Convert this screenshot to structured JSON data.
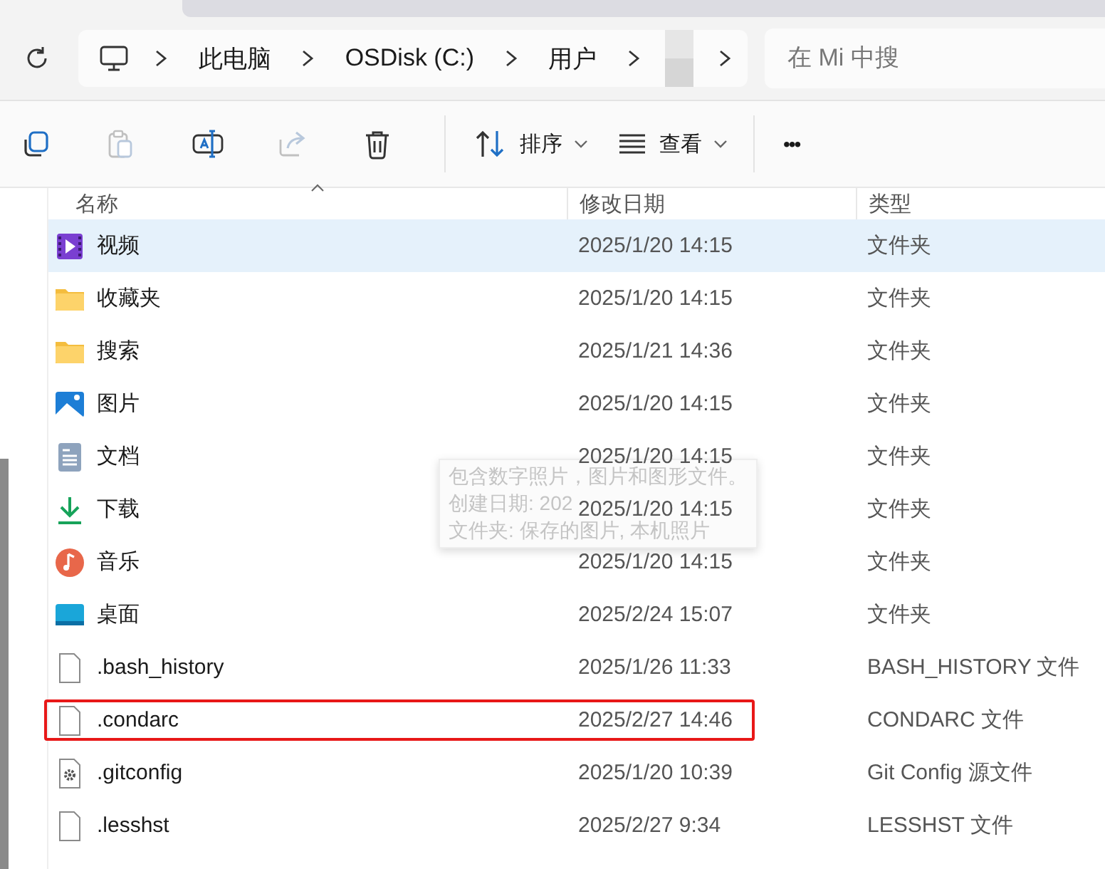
{
  "address_bar": {
    "breadcrumbs": [
      {
        "kind": "computer"
      },
      {
        "kind": "text",
        "label": "此电脑"
      },
      {
        "kind": "text",
        "label": "OSDisk (C:)"
      },
      {
        "kind": "text",
        "label": "用户"
      },
      {
        "kind": "redacted"
      }
    ]
  },
  "search": {
    "placeholder": "在 Mi 中搜"
  },
  "toolbar": {
    "buttons": [
      {
        "kind": "copy",
        "disabled": false
      },
      {
        "kind": "paste",
        "disabled": true
      },
      {
        "kind": "rename",
        "disabled": false
      },
      {
        "kind": "share",
        "disabled": true
      },
      {
        "kind": "delete",
        "disabled": false
      },
      {
        "kind": "sort",
        "label": "排序",
        "disabled": false
      },
      {
        "kind": "view",
        "label": "查看",
        "disabled": false
      },
      {
        "kind": "more",
        "label": "•••",
        "disabled": false
      }
    ]
  },
  "table": {
    "columns": [
      "名称",
      "修改日期",
      "类型"
    ],
    "rows": [
      {
        "kind": "video",
        "name": "视频",
        "modified": "2025/1/20 14:15",
        "type": "文件夹",
        "selected": true,
        "highlighted": false
      },
      {
        "kind": "folder",
        "name": "收藏夹",
        "modified": "2025/1/20 14:15",
        "type": "文件夹",
        "selected": false,
        "highlighted": false
      },
      {
        "kind": "folder",
        "name": "搜索",
        "modified": "2025/1/21 14:36",
        "type": "文件夹",
        "selected": false,
        "highlighted": false
      },
      {
        "kind": "picture",
        "name": "图片",
        "modified": "2025/1/20 14:15",
        "type": "文件夹",
        "selected": false,
        "highlighted": false
      },
      {
        "kind": "document",
        "name": "文档",
        "modified": "2025/1/20 14:15",
        "type": "文件夹",
        "selected": false,
        "highlighted": false
      },
      {
        "kind": "download",
        "name": "下载",
        "modified": "2025/1/20 14:15",
        "type": "文件夹",
        "selected": false,
        "highlighted": false
      },
      {
        "kind": "music",
        "name": "音乐",
        "modified": "2025/1/20 14:15",
        "type": "文件夹",
        "selected": false,
        "highlighted": false
      },
      {
        "kind": "desktop",
        "name": "桌面",
        "modified": "2025/2/24 15:07",
        "type": "文件夹",
        "selected": false,
        "highlighted": false
      },
      {
        "kind": "file",
        "name": ".bash_history",
        "modified": "2025/1/26 11:33",
        "type": "BASH_HISTORY 文件",
        "selected": false,
        "highlighted": false
      },
      {
        "kind": "file",
        "name": ".condarc",
        "modified": "2025/2/27 14:46",
        "type": "CONDARC 文件",
        "selected": false,
        "highlighted": true
      },
      {
        "kind": "config",
        "name": ".gitconfig",
        "modified": "2025/1/20 10:39",
        "type": "Git Config 源文件",
        "selected": false,
        "highlighted": false
      },
      {
        "kind": "file",
        "name": ".lesshst",
        "modified": "2025/2/27 9:34",
        "type": "LESSHST 文件",
        "selected": false,
        "highlighted": false
      }
    ]
  },
  "tooltip": {
    "lines": [
      "包含数字照片，图片和图形文件。",
      "创建日期: 202",
      "文件夹: 保存的图片, 本机照片"
    ]
  }
}
